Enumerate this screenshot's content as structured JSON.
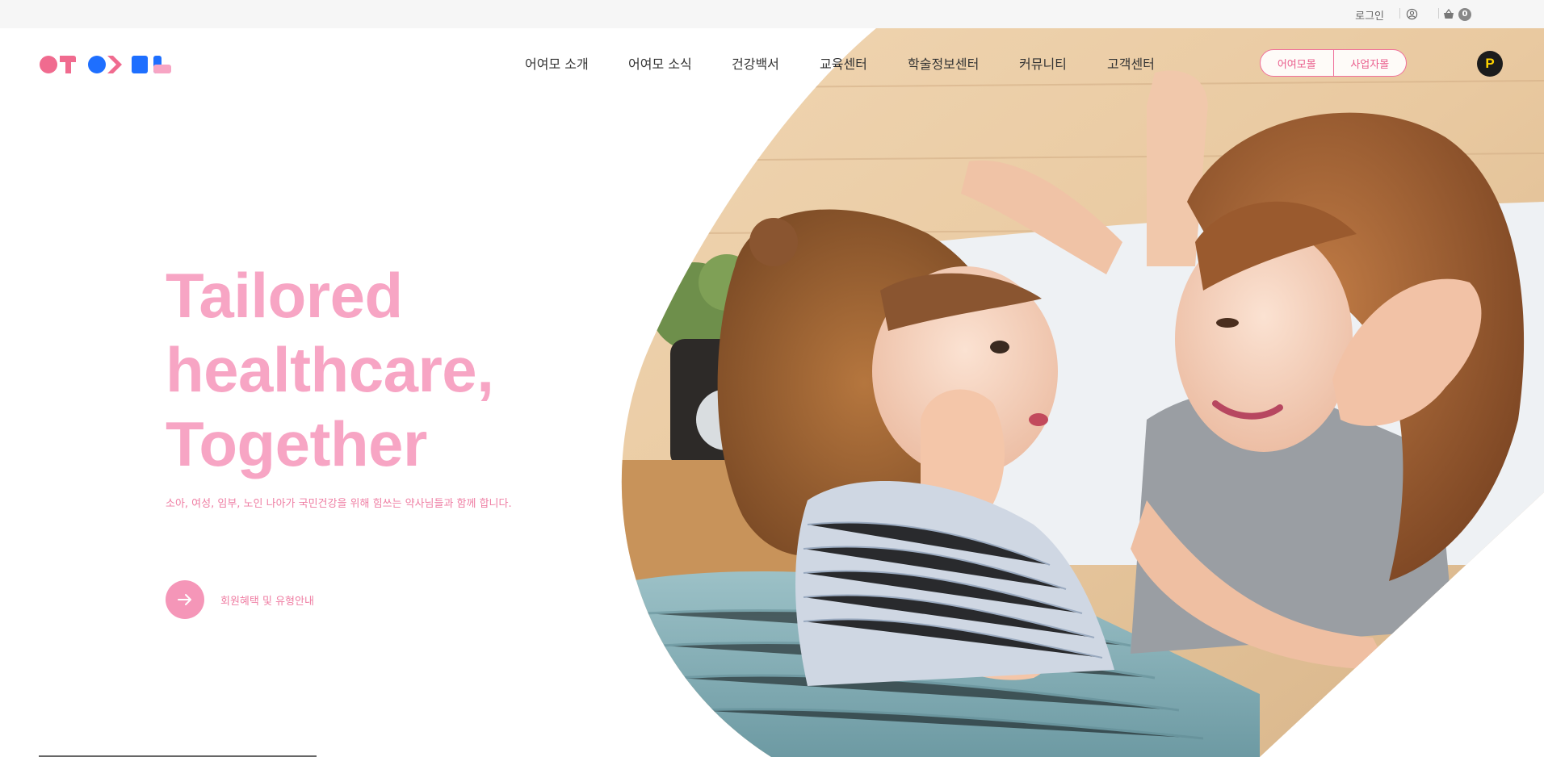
{
  "utility": {
    "login_label": "로그인",
    "user_icon": "user-circle-icon",
    "cart_icon": "basket-icon",
    "cart_count": "0"
  },
  "header": {
    "logo_icon": "brand-logo-icon",
    "nav": [
      {
        "label": "어여모 소개"
      },
      {
        "label": "어여모 소식"
      },
      {
        "label": "건강백서"
      },
      {
        "label": "교육센터"
      },
      {
        "label": "학술정보센터"
      },
      {
        "label": "커뮤니티"
      },
      {
        "label": "고객센터"
      }
    ],
    "mall_buttons": [
      {
        "label": "어여모몰"
      },
      {
        "label": "사업자몰"
      }
    ],
    "point_badge": "P"
  },
  "hero": {
    "title_lines": [
      "Tailored",
      "healthcare,",
      "Together"
    ],
    "subtitle": "소아, 여성, 임부, 노인 나아가 국민건강을 위해 힘쓰는 약사님들과 함께 합니다.",
    "cta_label": "회원혜택 및 유형안내",
    "cta_icon": "arrow-right-icon"
  },
  "colors": {
    "accent_pink": "#f7a5c4",
    "text_pink": "#ef7ea3",
    "logo_pink": "#f06b8f",
    "logo_blue": "#1e6fff"
  }
}
